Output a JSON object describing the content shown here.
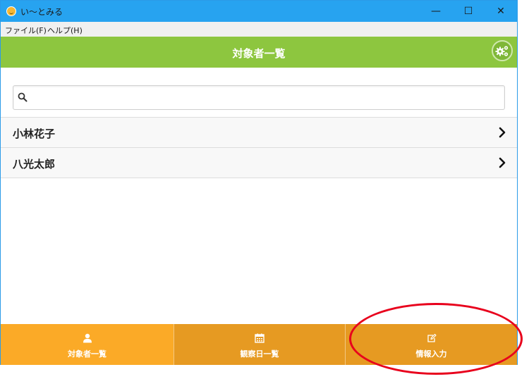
{
  "window": {
    "title": "い〜とみる",
    "controls": {
      "minimize": "—",
      "maximize": "☐",
      "close": "✕"
    }
  },
  "menubar": {
    "items": [
      {
        "label": "ファイル(F)"
      },
      {
        "label": "ヘルプ(H)"
      }
    ]
  },
  "header": {
    "title": "対象者一覧",
    "settings_icon": "gears-icon"
  },
  "search": {
    "value": "",
    "placeholder": ""
  },
  "list": {
    "items": [
      {
        "label": "小林花子"
      },
      {
        "label": "八光太郎"
      }
    ]
  },
  "tabs": [
    {
      "label": "対象者一覧",
      "icon": "user-icon"
    },
    {
      "label": "観察日一覧",
      "icon": "calendar-icon"
    },
    {
      "label": "情報入力",
      "icon": "edit-icon"
    }
  ],
  "colors": {
    "titlebar": "#27a3f0",
    "header": "#8dc63f",
    "tab_active": "#fbaa27",
    "tab_inactive": "#e69a22",
    "annotation": "#e8001c"
  }
}
